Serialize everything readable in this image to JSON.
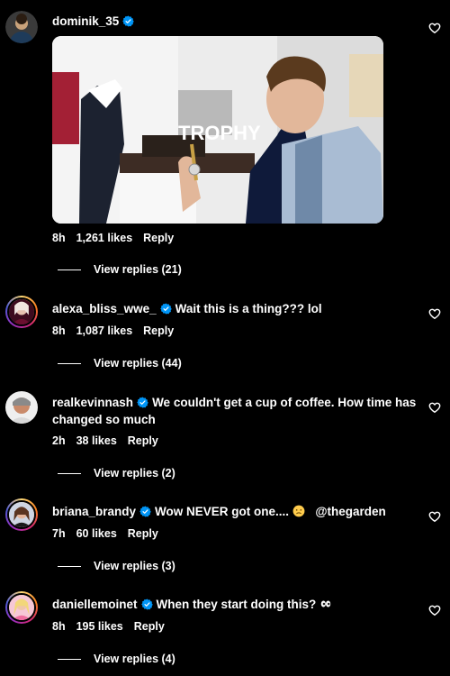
{
  "comments": [
    {
      "username": "dominik_35",
      "text": "",
      "time": "8h",
      "likes": "1,261 likes",
      "reply": "Reply",
      "view_replies": "View replies (21)",
      "media_overlay_text": "TROPHY"
    },
    {
      "username": "alexa_bliss_wwe_",
      "text": "Wait this is a thing??? lol",
      "time": "8h",
      "likes": "1,087 likes",
      "reply": "Reply",
      "view_replies": "View replies (44)"
    },
    {
      "username": "realkevinnash",
      "text": "We couldn't get a cup of coffee. How time has changed so much",
      "time": "2h",
      "likes": "38 likes",
      "reply": "Reply",
      "view_replies": "View replies (2)"
    },
    {
      "username": "briana_brandy",
      "text": "Wow NEVER got one....",
      "mention": "@thegarden",
      "time": "7h",
      "likes": "60 likes",
      "reply": "Reply",
      "view_replies": "View replies (3)"
    },
    {
      "username": "daniellemoinet",
      "text": "When they start doing this?",
      "time": "8h",
      "likes": "195 likes",
      "reply": "Reply",
      "view_replies": "View replies (4)"
    }
  ],
  "icons": {
    "verified": "verified-badge-icon",
    "like": "heart-icon",
    "emoji_sad": "disappointed-face-emoji",
    "emoji_eyes": "eyes-emoji"
  },
  "colors": {
    "background": "#000000",
    "text": "#ffffff",
    "verified": "#0095f6"
  }
}
